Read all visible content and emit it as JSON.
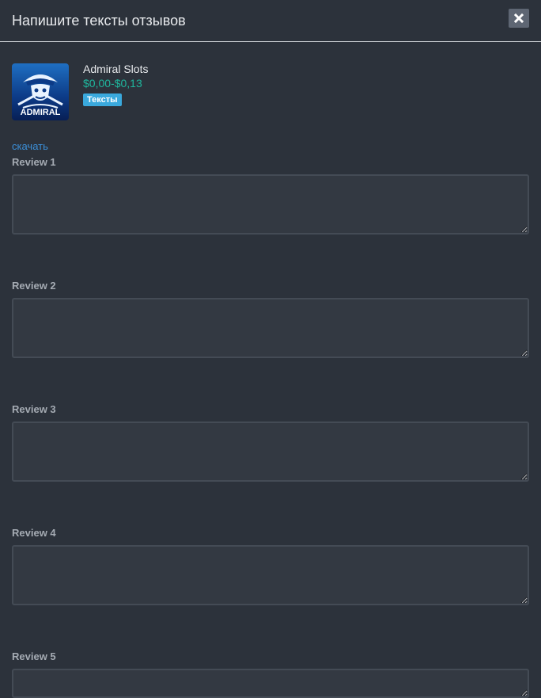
{
  "dialog": {
    "title": "Напишите тексты отзывов",
    "close_icon": "close-icon"
  },
  "app": {
    "name": "Admiral Slots",
    "price": "$0,00-$0,13",
    "badge": "Тексты",
    "logo_text": "ADMIRAL",
    "download_label": "скачать"
  },
  "reviews": [
    {
      "label": "Review 1",
      "value": ""
    },
    {
      "label": "Review 2",
      "value": ""
    },
    {
      "label": "Review 3",
      "value": ""
    },
    {
      "label": "Review 4",
      "value": ""
    },
    {
      "label": "Review 5",
      "value": ""
    }
  ],
  "colors": {
    "background": "#2c323b",
    "accent_price": "#1fb79e",
    "badge": "#3aa9dd",
    "link": "#3b8fd8"
  }
}
